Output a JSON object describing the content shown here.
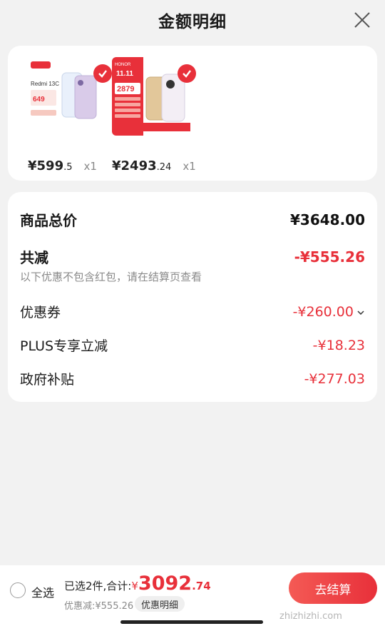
{
  "header": {
    "title": "金额明细",
    "close_icon": "close-icon"
  },
  "products": [
    {
      "price_main": "¥599",
      "price_decimal": ".5",
      "qty": "x1",
      "brand": "Redmi 13C",
      "promo_price": "649",
      "accent": "#e8303a"
    },
    {
      "price_main": "¥2493",
      "price_decimal": ".24",
      "qty": "x1",
      "brand": "HONOR",
      "promo_price": "2879",
      "accent": "#e8303a"
    }
  ],
  "summary": {
    "total_label": "商品总价",
    "total_value": "¥3648.00",
    "reduce_label": "共减",
    "reduce_value": "-¥555.26",
    "note": "以下优惠不包含红包，请在结算页查看",
    "items": [
      {
        "label": "优惠券",
        "value": "-¥260.00"
      },
      {
        "label": "PLUS专享立减",
        "value": "-¥18.23"
      },
      {
        "label": "政府补贴",
        "value": "-¥277.03"
      }
    ]
  },
  "bottom": {
    "select_all": "全选",
    "selected_text": "已选2件,合计:",
    "total_yen": "¥",
    "total_big": "3092",
    "total_decimal": ".74",
    "discount_text": "优惠减:¥555.26",
    "detail_button": "优惠明细",
    "checkout_button": "去结算"
  },
  "watermark": "zhizhizhi.com",
  "colors": {
    "accent": "#e8303a",
    "background": "#f2f2f2",
    "card": "#ffffff"
  }
}
